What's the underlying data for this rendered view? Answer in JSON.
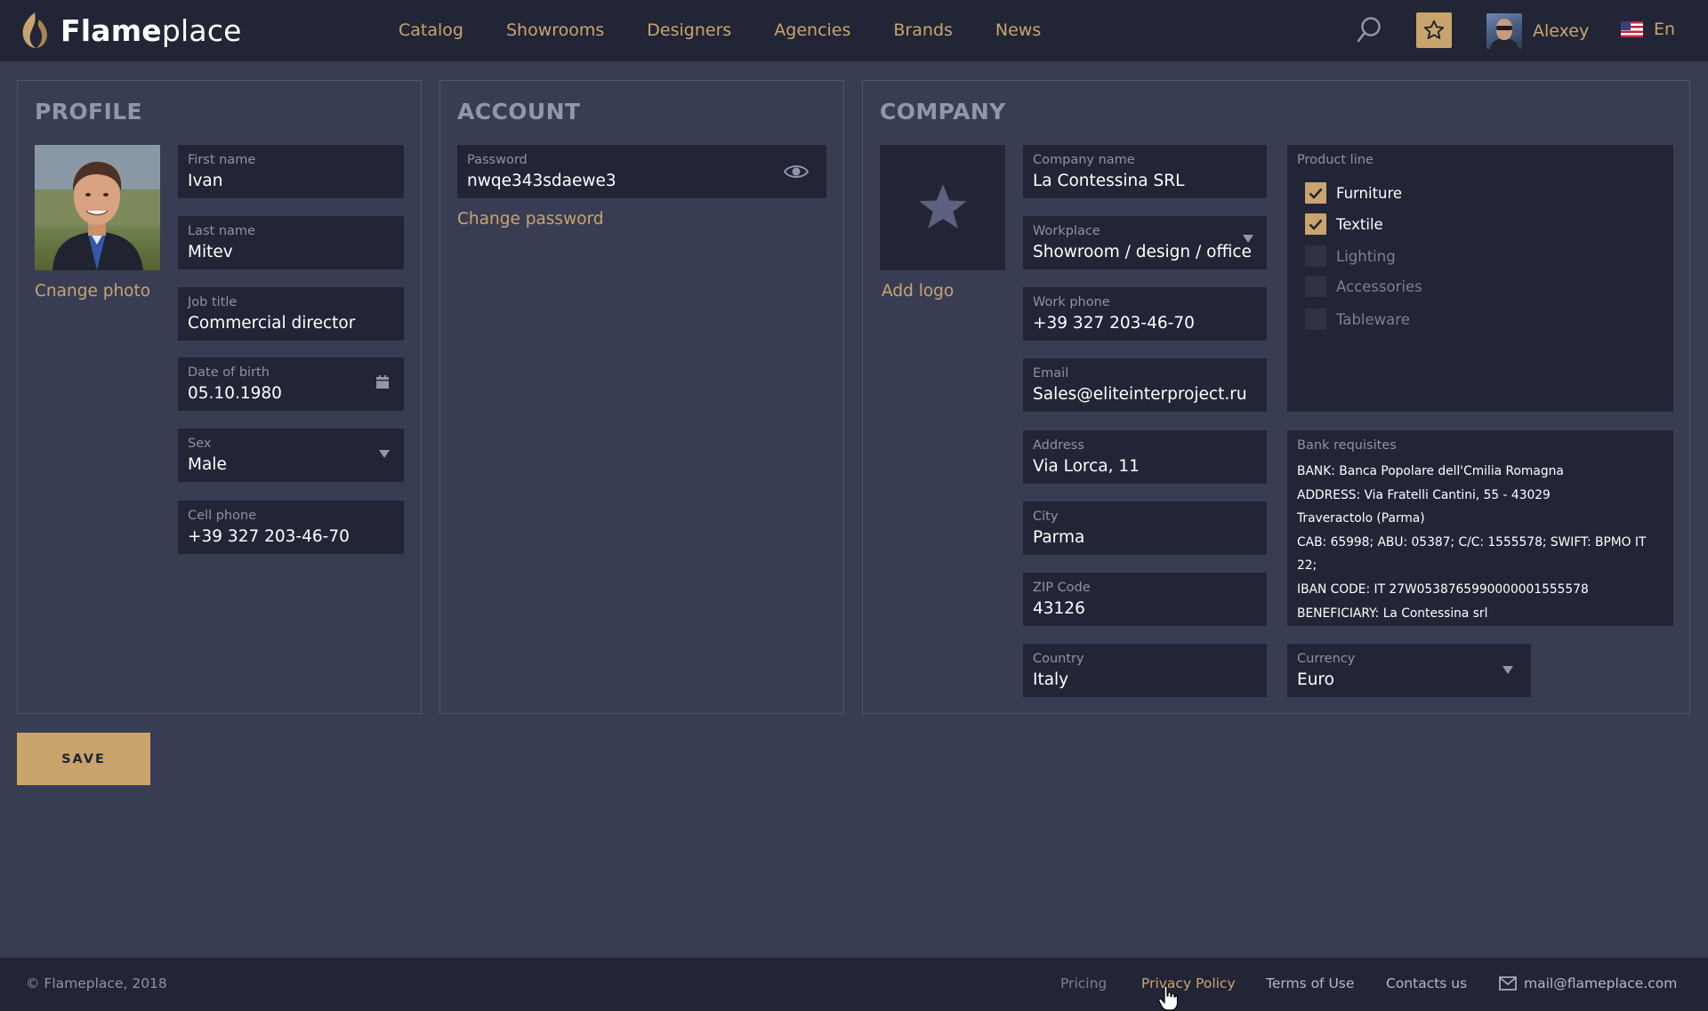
{
  "brand": {
    "name_bold": "Flame",
    "name_light": "place",
    "accent": "#c9a46d"
  },
  "nav": [
    "Catalog",
    "Showrooms",
    "Designers",
    "Agencies",
    "Brands",
    "News"
  ],
  "header": {
    "user_name": "Alexey",
    "language": "En"
  },
  "profile": {
    "title": "PROFILE",
    "change_photo": "Cnange photo",
    "first_name": {
      "label": "First name",
      "value": "Ivan"
    },
    "last_name": {
      "label": "Last name",
      "value": "Mitev"
    },
    "job_title": {
      "label": "Job title",
      "value": "Commercial director"
    },
    "dob": {
      "label": "Date of birth",
      "value": "05.10.1980"
    },
    "sex": {
      "label": "Sex",
      "value": "Male"
    },
    "cell_phone": {
      "label": "Cell phone",
      "value": "+39 327 203-46-70"
    }
  },
  "account": {
    "title": "ACCOUNT",
    "password": {
      "label": "Password",
      "value": "nwqe343sdaewe3"
    },
    "change_password": "Change password"
  },
  "company": {
    "title": "COMPANY",
    "add_logo": "Add logo",
    "company_name": {
      "label": "Company name",
      "value": "La Contessina SRL"
    },
    "workplace": {
      "label": "Workplace",
      "value": "Showroom / design / office"
    },
    "work_phone": {
      "label": "Work phone",
      "value": "+39 327 203-46-70"
    },
    "email": {
      "label": "Email",
      "value": "Sales@eliteinterproject.ru"
    },
    "address": {
      "label": "Address",
      "value": "Via Lorca, 11"
    },
    "city": {
      "label": "City",
      "value": "Parma"
    },
    "zip": {
      "label": "ZIP Code",
      "value": "43126"
    },
    "country": {
      "label": "Country",
      "value": "Italy"
    },
    "currency": {
      "label": "Currency",
      "value": "Euro"
    },
    "product_line": {
      "label": "Product line",
      "items": [
        {
          "label": "Furniture",
          "checked": true
        },
        {
          "label": "Textile",
          "checked": true
        },
        {
          "label": "Lighting",
          "checked": false
        },
        {
          "label": "Accessories",
          "checked": false
        },
        {
          "label": "Tableware",
          "checked": false
        }
      ]
    },
    "bank": {
      "label": "Bank requisites",
      "lines": [
        "BANK: Banca Popolare dell'Cmilia Romagna",
        "ADDRESS: Via Fratelli Cantini, 55 - 43029",
        "Traveractolo (Parma)",
        "CAB: 65998; ABU: 05387; C/C: 1555578; SWIFT: BPMO IT 22;",
        "IBAN CODE: IT 27W0538765990000001555578",
        "BENEFICIARY: La Contessina srl"
      ]
    }
  },
  "save_label": "SAVE",
  "footer": {
    "copyright": "© Flameplace, 2018",
    "links": [
      "Pricing",
      "Privacy Policy",
      "Terms of Use",
      "Contacts us"
    ],
    "email": "mail@flameplace.com"
  }
}
